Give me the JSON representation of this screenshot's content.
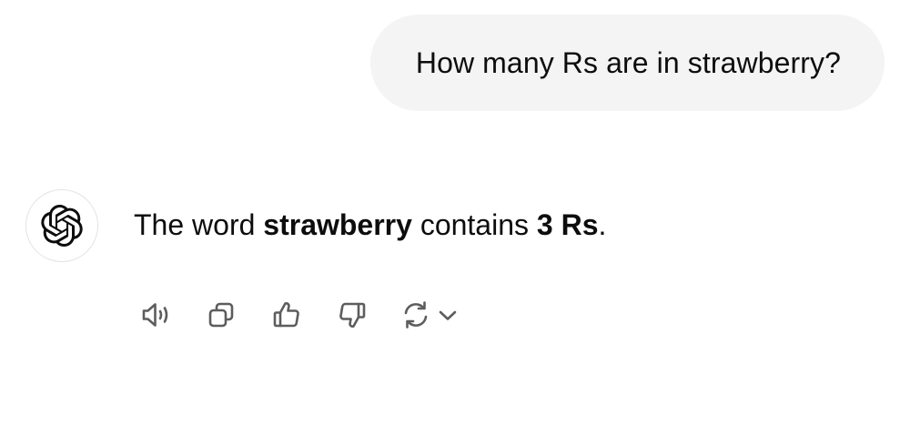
{
  "user_message": {
    "text": "How many Rs are in strawberry?"
  },
  "assistant_message": {
    "prefix": "The word ",
    "word": "strawberry",
    "middle": " contains ",
    "answer": "3 Rs",
    "suffix": "."
  },
  "actions": {
    "icons": [
      "read-aloud-icon",
      "copy-icon",
      "thumbs-up-icon",
      "thumbs-down-icon",
      "regenerate-icon",
      "chevron-down-icon"
    ]
  },
  "colors": {
    "bubble_bg": "#f4f4f4",
    "icon": "#5d5d5d",
    "text": "#0d0d0d"
  }
}
